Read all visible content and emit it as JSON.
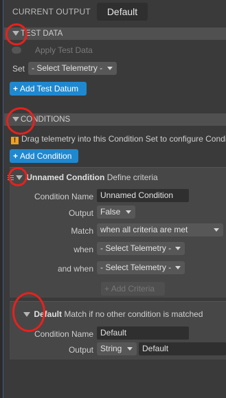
{
  "current_output": {
    "label": "CURRENT OUTPUT",
    "value": "Default"
  },
  "test_data": {
    "header": "TEST DATA",
    "apply_label": "Apply Test Data",
    "set_label": "Set",
    "telemetry_select": "- Select Telemetry -",
    "add_button": "Add Test Datum"
  },
  "conditions": {
    "header": "CONDITIONS",
    "warning": "Drag telemetry into this Condition Set to configure Conditions and add criteria.",
    "add_button": "Add Condition",
    "unnamed": {
      "name": "Unnamed Condition",
      "desc": "Define criteria",
      "name_label": "Condition Name",
      "name_value": "Unnamed Condition",
      "output_label": "Output",
      "output_value": "False",
      "match_label": "Match",
      "match_value": "when all criteria are met",
      "when_label": "when",
      "when_value": "- Select Telemetry -",
      "and_when_label": "and when",
      "and_when_value": "- Select Telemetry -",
      "add_criteria": "Add Criteria"
    },
    "default": {
      "name": "Default",
      "desc": "Match if no other condition is matched",
      "name_label": "Condition Name",
      "name_value": "Default",
      "output_label": "Output",
      "output_type": "String",
      "output_value": "Default"
    }
  },
  "colors": {
    "accent": "#1f88cf",
    "annotation": "#e8211c",
    "warning": "#f0a020"
  },
  "icons": [
    "triangle-down-icon",
    "plus-icon",
    "warning-icon",
    "drag-grip-icon",
    "caret-down-icon"
  ]
}
